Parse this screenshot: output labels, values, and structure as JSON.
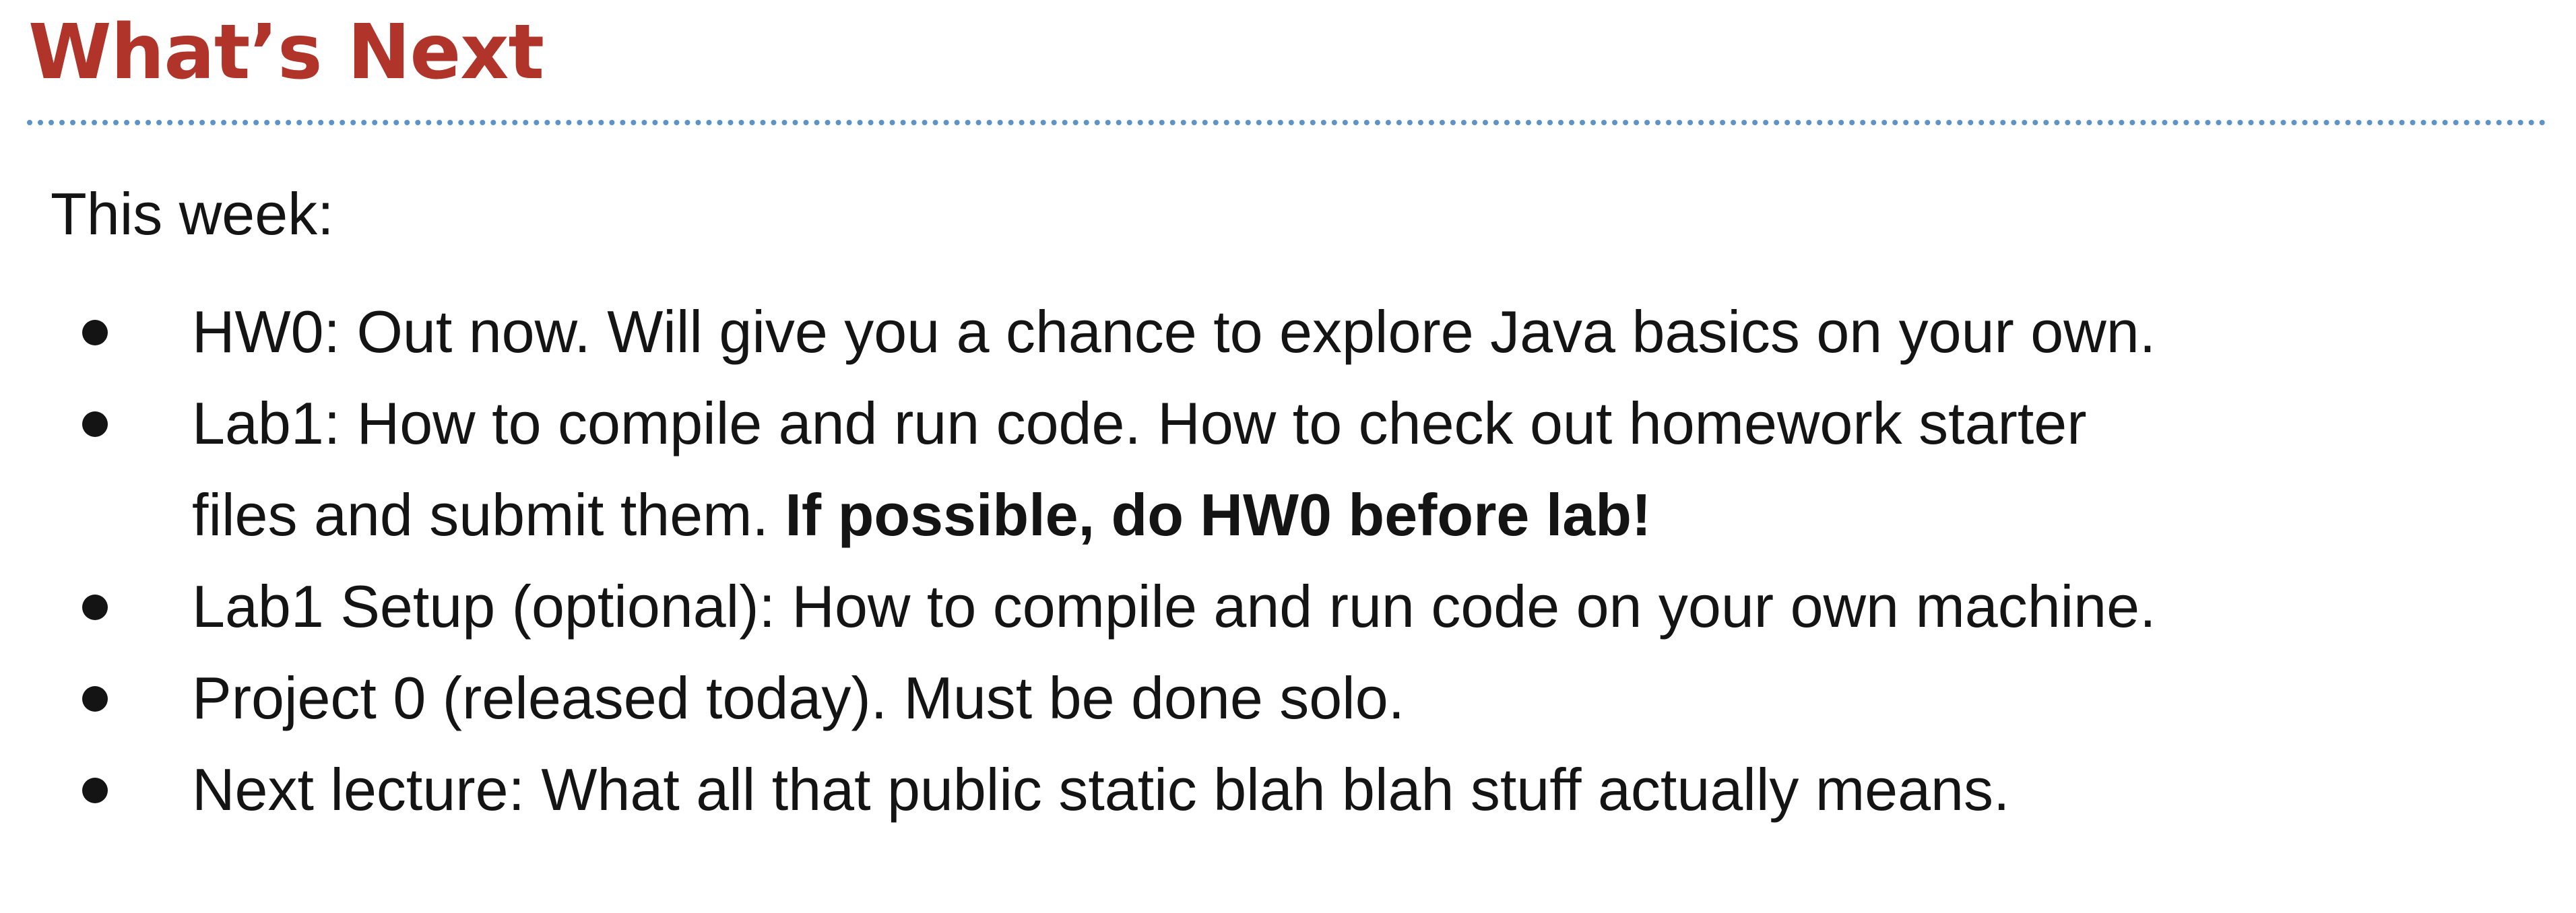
{
  "slide": {
    "title": "What’s Next",
    "intro": "This week:",
    "bullets": [
      {
        "lines": [
          "HW0: Out now. Will give you a chance to explore Java basics on your own."
        ]
      },
      {
        "line1": "Lab1: How to compile and run code. How to check out homework starter",
        "line2_plain": "files and submit them. ",
        "line2_bold": "If possible, do HW0 before lab!"
      },
      {
        "lines": [
          "Lab1 Setup (optional): How to compile and run code on your own machine."
        ]
      },
      {
        "lines": [
          "Project 0 (released today). Must be done solo."
        ]
      },
      {
        "lines": [
          "Next lecture: What all that public static blah blah stuff actually means."
        ]
      }
    ]
  },
  "colors": {
    "title": "#b03429",
    "divider": "#5d93c6",
    "text": "#141414",
    "background": "#ffffff"
  }
}
